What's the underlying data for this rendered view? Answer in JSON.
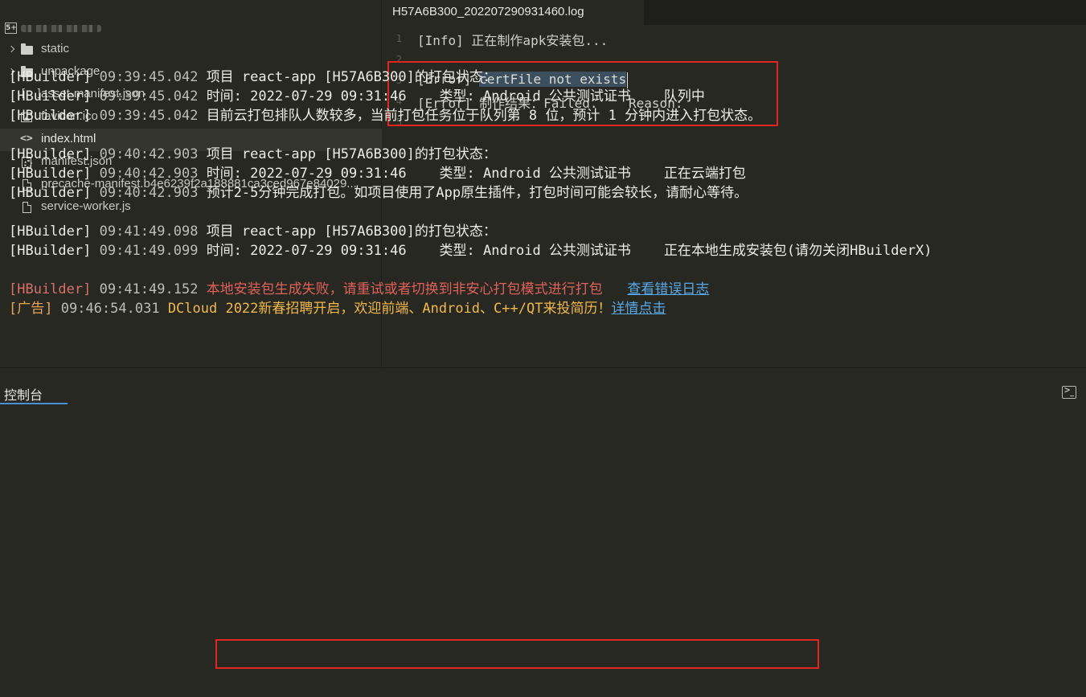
{
  "sidebar": {
    "project_badge": "5+",
    "items": [
      {
        "label": "static",
        "type": "folder",
        "icon": "folder-icon"
      },
      {
        "label": "unpackage",
        "type": "folder",
        "icon": "folder-icon"
      },
      {
        "label": "asset-manifest.json",
        "type": "file",
        "icon": "json-brackets-icon",
        "glyph": "[ ]"
      },
      {
        "label": "favicon.ico",
        "type": "file",
        "icon": "image-icon"
      },
      {
        "label": "index.html",
        "type": "file",
        "icon": "code-icon",
        "glyph": "<>",
        "selected": true
      },
      {
        "label": "manifest.json",
        "type": "file",
        "icon": "settings-file-icon"
      },
      {
        "label": "precache-manifest.b4e6239f2a188881ca3ced967e84029...",
        "type": "file",
        "icon": "file-icon"
      },
      {
        "label": "service-worker.js",
        "type": "file",
        "icon": "file-icon"
      }
    ]
  },
  "editor": {
    "tab_title": "H57A6B300_202207290931460.log",
    "lines": [
      {
        "num": "1",
        "text": "[Info] 正在制作apk安装包..."
      },
      {
        "num": "2",
        "text": ""
      },
      {
        "num": "3",
        "prefix": "[Error] ",
        "highlight": "certFile not exists"
      },
      {
        "num": "4",
        "text": "[Error] 制作结果：Failed.    Reason:"
      },
      {
        "num": "5",
        "text": ""
      }
    ]
  },
  "console": {
    "title": "控制台",
    "lines": [
      {
        "tag": "[HBuilder]",
        "time": "09:39:45.042",
        "msg": "项目 react-app [H57A6B300]的打包状态："
      },
      {
        "tag": "[HBuilder]",
        "time": "09:39:45.042",
        "msg": "时间: 2022-07-29 09:31:46    类型: Android 公共测试证书    队列中"
      },
      {
        "tag": "[HBuilder]",
        "time": "09:39:45.042",
        "msg": "目前云打包排队人数较多，当前打包任务位于队列第 8 位，预计 1 分钟内进入打包状态。"
      },
      {
        "gap": true
      },
      {
        "tag": "[HBuilder]",
        "time": "09:40:42.903",
        "msg": "项目 react-app [H57A6B300]的打包状态："
      },
      {
        "tag": "[HBuilder]",
        "time": "09:40:42.903",
        "msg": "时间: 2022-07-29 09:31:46    类型: Android 公共测试证书    正在云端打包"
      },
      {
        "tag": "[HBuilder]",
        "time": "09:40:42.903",
        "msg": "预计2-5分钟完成打包。如项目使用了App原生插件，打包时间可能会较长，请耐心等待。"
      },
      {
        "gap": true
      },
      {
        "tag": "[HBuilder]",
        "time": "09:41:49.098",
        "msg": "项目 react-app [H57A6B300]的打包状态："
      },
      {
        "tag": "[HBuilder]",
        "time": "09:41:49.099",
        "msg": "时间: 2022-07-29 09:31:46    类型: Android 公共测试证书    正在本地生成安装包(请勿关闭HBuilderX)"
      },
      {
        "gap": true
      },
      {
        "tag": "[HBuilder]",
        "time": "09:41:49.152",
        "msg": "本地安装包生成失败，请重试或者切换到非安心打包模式进行打包",
        "link": "查看错误日志",
        "kind": "error"
      },
      {
        "tag": "[广告]",
        "time": "09:46:54.031",
        "msg": "DCloud 2022新春招聘开启，欢迎前端、Android、C++/QT来投简历！",
        "link": "详情点击",
        "kind": "ad"
      }
    ]
  },
  "colors": {
    "background": "#272822",
    "error_red": "#e0261e",
    "link_blue": "#58a8e8",
    "ad_orange": "#f2b84a"
  }
}
